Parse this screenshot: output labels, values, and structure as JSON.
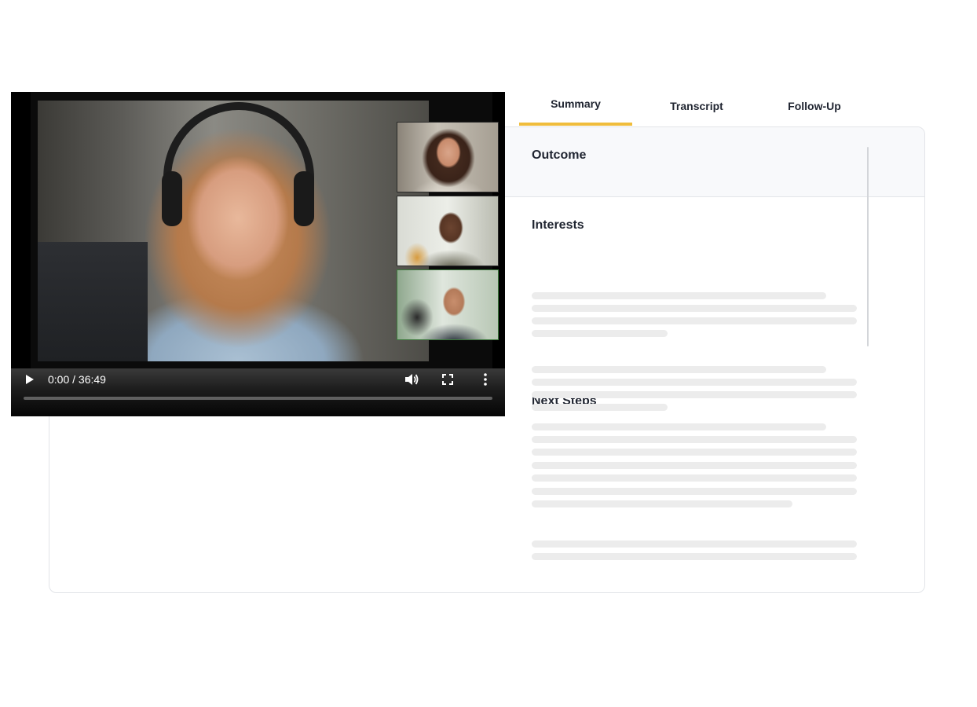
{
  "player": {
    "time_display": "0:00 / 36:49",
    "progress": 0,
    "icons": {
      "play": "play-icon",
      "volume": "volume-icon",
      "fullscreen": "fullscreen-icon",
      "more": "more-vertical-icon"
    }
  },
  "tabs": [
    {
      "label": "Summary",
      "active": true
    },
    {
      "label": "Transcript",
      "active": false
    },
    {
      "label": "Follow-Up",
      "active": false
    }
  ],
  "summary": {
    "sections": [
      {
        "title": "Outcome"
      },
      {
        "title": "Interests"
      },
      {
        "title": ""
      },
      {
        "title": "Next Steps"
      }
    ]
  },
  "colors": {
    "accent": "#f0bd3c",
    "placeholder_line": "#ececec",
    "header_bg": "#f8f9fb",
    "text": "#1f2430"
  }
}
